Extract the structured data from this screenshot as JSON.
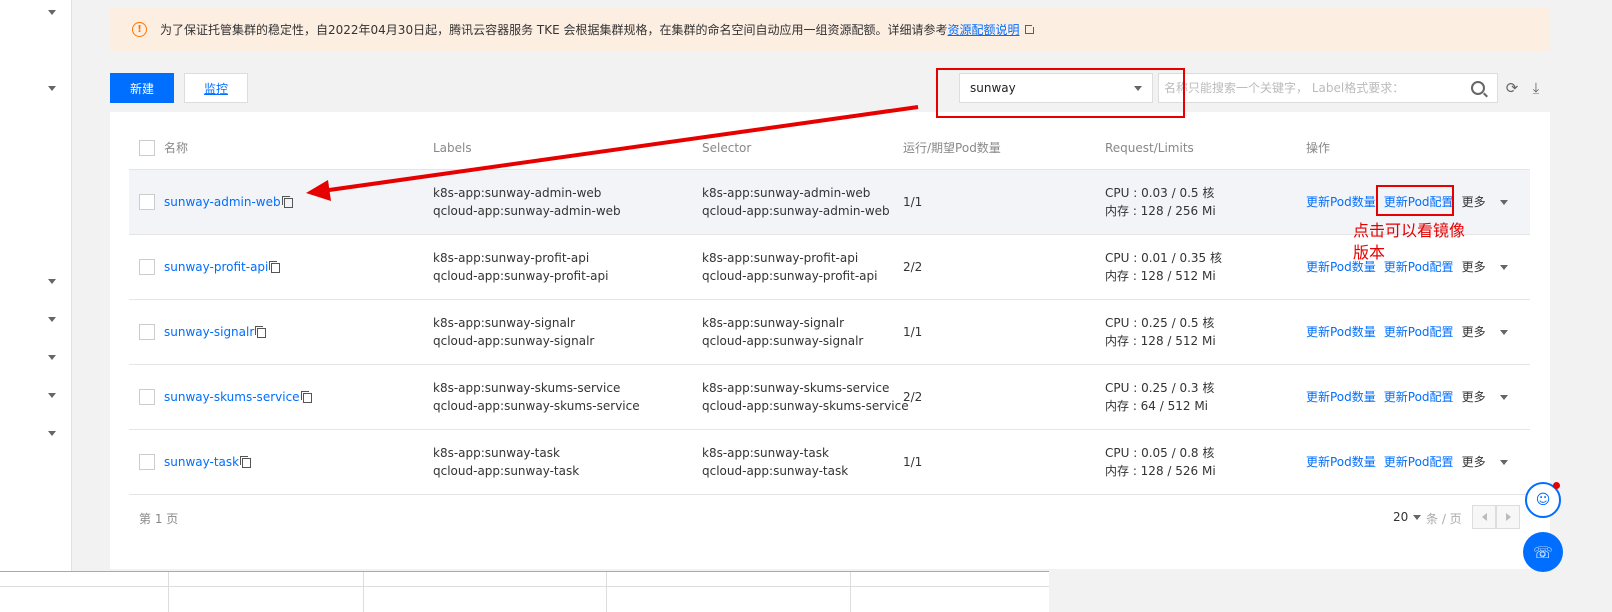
{
  "notice": {
    "text": "为了保证托管集群的稳定性，自2022年04月30日起，腾讯云容器服务 TKE 会根据集群规格，在集群的命名空间自动应用一组资源配额。详细请参考",
    "link": "资源配额说明"
  },
  "toolbar": {
    "create_label": "新建",
    "monitor_label": "监控",
    "namespace_value": "sunway",
    "search_placeholder": "名称只能搜索一个关键字， Label格式要求："
  },
  "table": {
    "columns": [
      "名称",
      "Labels",
      "Selector",
      "运行/期望Pod数量",
      "Request/Limits",
      "操作"
    ],
    "rows": [
      {
        "name": "sunway-admin-web",
        "labels": [
          "k8s-app:sunway-admin-web",
          "qcloud-app:sunway-admin-web"
        ],
        "selector": [
          "k8s-app:sunway-admin-web",
          "qcloud-app:sunway-admin-web"
        ],
        "pods": "1/1",
        "cpu": "CPU : 0.03 / 0.5 核",
        "mem": "内存 : 128 / 256 Mi"
      },
      {
        "name": "sunway-profit-api",
        "labels": [
          "k8s-app:sunway-profit-api",
          "qcloud-app:sunway-profit-api"
        ],
        "selector": [
          "k8s-app:sunway-profit-api",
          "qcloud-app:sunway-profit-api"
        ],
        "pods": "2/2",
        "cpu": "CPU : 0.01 / 0.35 核",
        "mem": "内存 : 128 / 512 Mi"
      },
      {
        "name": "sunway-signalr",
        "labels": [
          "k8s-app:sunway-signalr",
          "qcloud-app:sunway-signalr"
        ],
        "selector": [
          "k8s-app:sunway-signalr",
          "qcloud-app:sunway-signalr"
        ],
        "pods": "1/1",
        "cpu": "CPU : 0.25 / 0.5 核",
        "mem": "内存 : 128 / 512 Mi"
      },
      {
        "name": "sunway-skums-service",
        "labels": [
          "k8s-app:sunway-skums-service",
          "qcloud-app:sunway-skums-service"
        ],
        "selector": [
          "k8s-app:sunway-skums-service",
          "qcloud-app:sunway-skums-service"
        ],
        "pods": "2/2",
        "cpu": "CPU : 0.25 / 0.3 核",
        "mem": "内存 : 64 / 512 Mi"
      },
      {
        "name": "sunway-task",
        "labels": [
          "k8s-app:sunway-task",
          "qcloud-app:sunway-task"
        ],
        "selector": [
          "k8s-app:sunway-task",
          "qcloud-app:sunway-task"
        ],
        "pods": "1/1",
        "cpu": "CPU : 0.05 / 0.8 核",
        "mem": "内存 : 128 / 526 Mi"
      }
    ],
    "actions": {
      "update_count": "更新Pod数量",
      "update_config": "更新Pod配置",
      "more": "更多"
    }
  },
  "pager": {
    "page_text": "第 1 页",
    "page_size": "20",
    "unit": "条 / 页"
  },
  "annotation": {
    "line1": "点击可以看镜像",
    "line2": "版本"
  },
  "colors": {
    "primary": "#006eff",
    "warning": "#ff7200",
    "annotation_red": "#e60000",
    "notice_bg": "#fdeee2"
  }
}
